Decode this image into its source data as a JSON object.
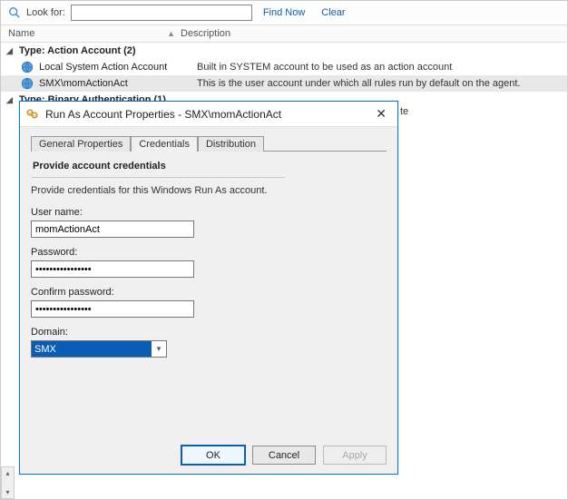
{
  "search": {
    "icon": "magnifier-icon",
    "label": "Look for:",
    "value": "",
    "find": "Find Now",
    "clear": "Clear"
  },
  "columns": {
    "name": "Name",
    "description": "Description"
  },
  "groups": [
    {
      "label": "Type: Action Account (2)",
      "items": [
        {
          "name": "Local System Action Account",
          "desc": "Built in SYSTEM account to be used as an action account",
          "selected": false
        },
        {
          "name": "SMX\\momActionAct",
          "desc": "This is the user account under which all rules run by default on the agent.",
          "selected": true
        }
      ]
    },
    {
      "label": "Type: Binary Authentication (1)",
      "items": []
    }
  ],
  "peek": "te",
  "dialog": {
    "title": "Run As Account Properties - SMX\\momActionAct",
    "tabs": {
      "general": "General Properties",
      "credentials": "Credentials",
      "distribution": "Distribution"
    },
    "section_head": "Provide account credentials",
    "hint": "Provide credentials for this Windows Run As account.",
    "fields": {
      "username_label": "User name:",
      "username_value": "momActionAct",
      "password_label": "Password:",
      "password_value": "••••••••••••••••",
      "confirm_label": "Confirm password:",
      "confirm_value": "••••••••••••••••",
      "domain_label": "Domain:",
      "domain_value": "SMX"
    },
    "buttons": {
      "ok": "OK",
      "cancel": "Cancel",
      "apply": "Apply"
    }
  }
}
